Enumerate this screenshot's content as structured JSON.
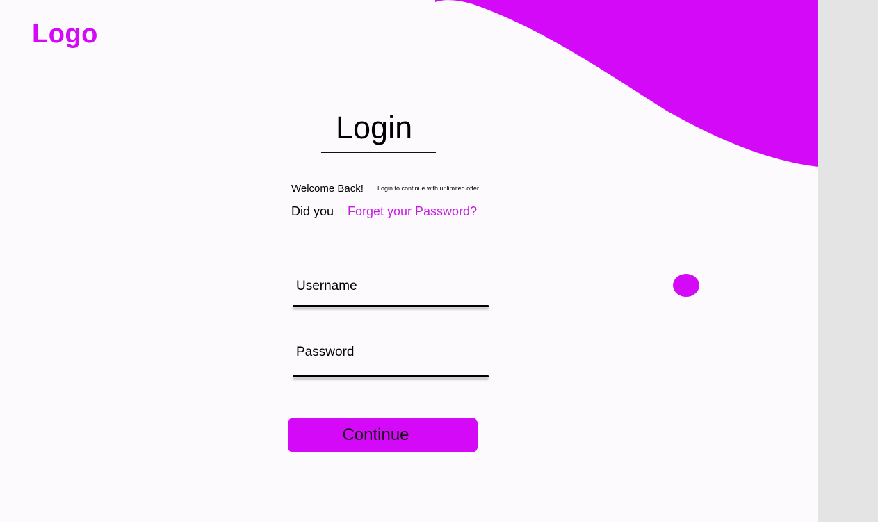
{
  "header": {
    "logo_text": "Logo"
  },
  "login": {
    "title": "Login",
    "welcome": "Welcome Back!",
    "welcome_sub": "Login to continue with unlimited offer",
    "did_you": "Did you",
    "forgot_link": "Forget your Password?",
    "username_placeholder": "Username",
    "password_placeholder": "Password",
    "continue_label": "Continue"
  },
  "colors": {
    "accent": "#d409f7",
    "link": "#c61fe2",
    "background": "#fcfafc",
    "side_gutter": "#e4e4e4"
  }
}
